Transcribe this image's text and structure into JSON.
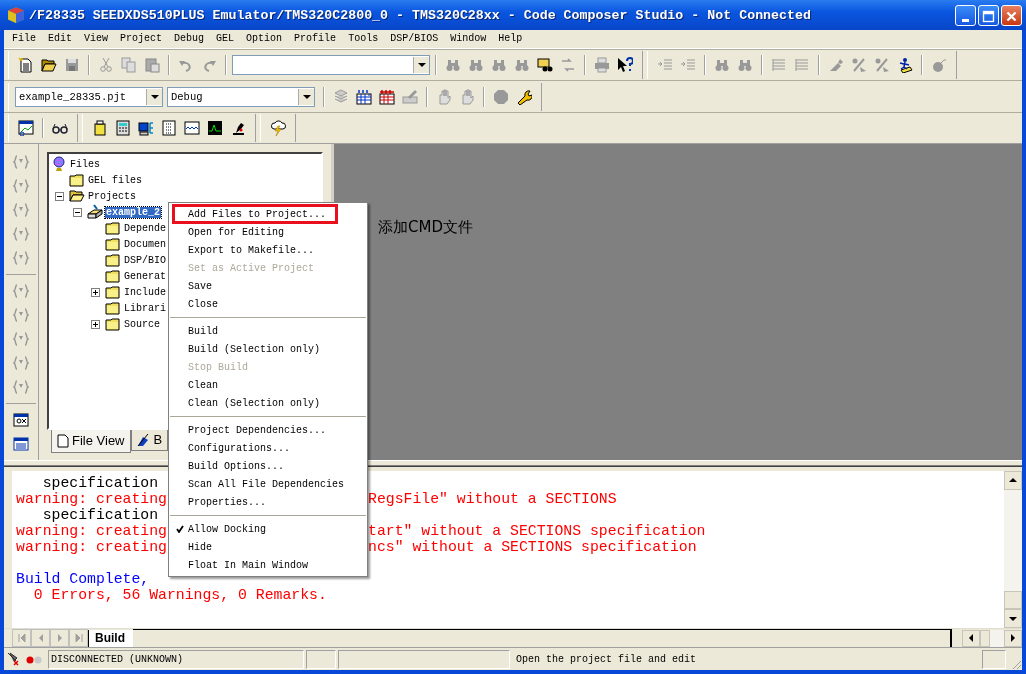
{
  "window": {
    "title": "/F28335 SEEDXDS510PLUS Emulator/TMS320C2800_0 - TMS320C28xx - Code Composer Studio - Not Connected"
  },
  "menu_bar": [
    "File",
    "Edit",
    "View",
    "Project",
    "Debug",
    "GEL",
    "Option",
    "Profile",
    "Tools",
    "DSP/BIOS",
    "Window",
    "Help"
  ],
  "project_bar": {
    "project": "example_28335.pjt",
    "configuration": "Debug"
  },
  "project_tree": [
    {
      "label": "Files",
      "kind": "root",
      "selected": false,
      "children": [
        {
          "label": "GEL files",
          "kind": "folder",
          "selected": false
        },
        {
          "label": "Projects",
          "kind": "open-folder",
          "selected": false,
          "expanded": true,
          "children": [
            {
              "label": "example_2",
              "kind": "project",
              "selected": true,
              "expanded": true,
              "children": [
                {
                  "label": "Depende",
                  "kind": "folder",
                  "selected": false
                },
                {
                  "label": "Documen",
                  "kind": "folder",
                  "selected": false
                },
                {
                  "label": "DSP/BIO",
                  "kind": "folder",
                  "selected": false
                },
                {
                  "label": "Generat",
                  "kind": "folder",
                  "selected": false
                },
                {
                  "label": "Include",
                  "kind": "folder",
                  "selected": false,
                  "expanded": false
                },
                {
                  "label": "Librari",
                  "kind": "folder",
                  "selected": false
                },
                {
                  "label": "Source",
                  "kind": "folder",
                  "selected": false,
                  "expanded": false
                }
              ]
            }
          ]
        }
      ]
    }
  ],
  "panel_tabs": [
    {
      "label": "File View",
      "selected": true
    },
    {
      "label": "B",
      "selected": false
    }
  ],
  "editor_area": {
    "note": "添加CMD文件"
  },
  "context_menu": [
    {
      "kind": "item",
      "label": "Add Files to Project...",
      "disabled": false,
      "checked": false,
      "marked": true
    },
    {
      "kind": "item",
      "label": "Open for Editing",
      "disabled": false,
      "checked": false,
      "marked": false
    },
    {
      "kind": "item",
      "label": "Export to Makefile...",
      "disabled": false,
      "checked": false,
      "marked": false
    },
    {
      "kind": "item",
      "label": "Set as Active Project",
      "disabled": true,
      "checked": false,
      "marked": false
    },
    {
      "kind": "item",
      "label": "Save",
      "disabled": false,
      "checked": false,
      "marked": false
    },
    {
      "kind": "item",
      "label": "Close",
      "disabled": false,
      "checked": false,
      "marked": false
    },
    {
      "kind": "separator"
    },
    {
      "kind": "item",
      "label": "Build",
      "disabled": false,
      "checked": false,
      "marked": false
    },
    {
      "kind": "item",
      "label": "Build (Selection only)",
      "disabled": false,
      "checked": false,
      "marked": false
    },
    {
      "kind": "item",
      "label": "Stop Build",
      "disabled": true,
      "checked": false,
      "marked": false
    },
    {
      "kind": "item",
      "label": "Clean",
      "disabled": false,
      "checked": false,
      "marked": false
    },
    {
      "kind": "item",
      "label": "Clean (Selection only)",
      "disabled": false,
      "checked": false,
      "marked": false
    },
    {
      "kind": "separator"
    },
    {
      "kind": "item",
      "label": "Project Dependencies...",
      "disabled": false,
      "checked": false,
      "marked": false
    },
    {
      "kind": "item",
      "label": "Configurations...",
      "disabled": false,
      "checked": false,
      "marked": false
    },
    {
      "kind": "item",
      "label": "Build Options...",
      "disabled": false,
      "checked": false,
      "marked": false
    },
    {
      "kind": "item",
      "label": "Scan All File Dependencies",
      "disabled": false,
      "checked": false,
      "marked": false
    },
    {
      "kind": "item",
      "label": "Properties...",
      "disabled": false,
      "checked": false,
      "marked": false
    },
    {
      "kind": "separator"
    },
    {
      "kind": "item",
      "label": "Allow Docking",
      "disabled": false,
      "checked": true,
      "marked": false
    },
    {
      "kind": "item",
      "label": "Hide",
      "disabled": false,
      "checked": false,
      "marked": false
    },
    {
      "kind": "item",
      "label": "Float In Main Window",
      "disabled": false,
      "checked": false,
      "marked": false
    }
  ],
  "output": [
    {
      "kind": "plain",
      "text": "   specification"
    },
    {
      "kind": "warning",
      "text": "warning: creating",
      "tail": "RegsFile\" without a SECTIONS"
    },
    {
      "kind": "plain",
      "text": "   specification"
    },
    {
      "kind": "warning",
      "text": "warning: creating",
      "tail": "tart\" without a SECTIONS specification"
    },
    {
      "kind": "warning",
      "text": "warning: creating",
      "tail": "ncs\" without a SECTIONS specification"
    },
    {
      "kind": "info",
      "text": "Build Complete,"
    },
    {
      "kind": "summary",
      "text": "  0 Errors, 56 Warnings, 0 Remarks."
    }
  ],
  "output_tabs": [
    {
      "label": "Build",
      "selected": true
    }
  ],
  "status_bar": {
    "connection": "DISCONNECTED (UNKNOWN)",
    "message": "Open the project file and edit"
  }
}
